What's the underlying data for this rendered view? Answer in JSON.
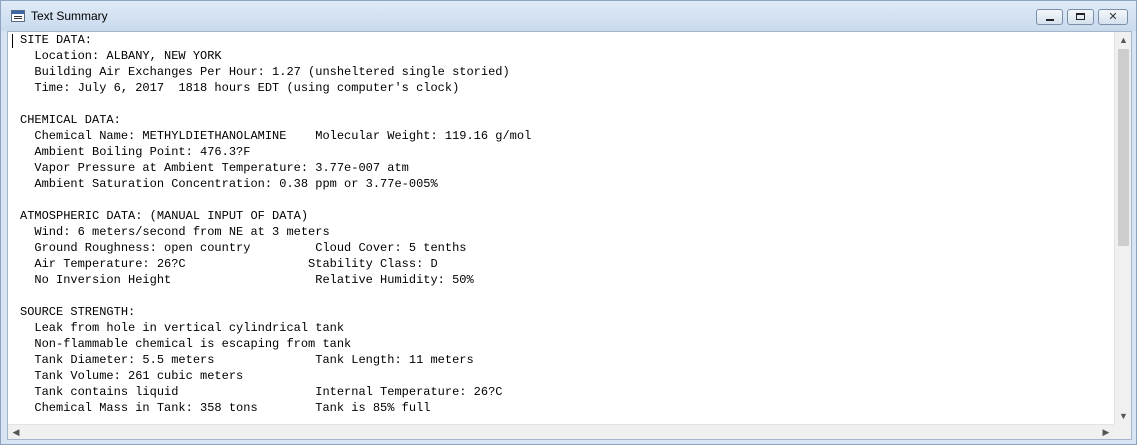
{
  "window": {
    "title": "Text Summary",
    "controls": {
      "minimize": "minimize",
      "maximize": "maximize",
      "close": "✕"
    }
  },
  "summary": {
    "lines": [
      "SITE DATA:",
      "  Location: ALBANY, NEW YORK",
      "  Building Air Exchanges Per Hour: 1.27 (unsheltered single storied)",
      "  Time: July 6, 2017  1818 hours EDT (using computer's clock)",
      "",
      "CHEMICAL DATA:",
      "  Chemical Name: METHYLDIETHANOLAMINE    Molecular Weight: 119.16 g/mol",
      "  Ambient Boiling Point: 476.3?F",
      "  Vapor Pressure at Ambient Temperature: 3.77e-007 atm",
      "  Ambient Saturation Concentration: 0.38 ppm or 3.77e-005%",
      "",
      "ATMOSPHERIC DATA: (MANUAL INPUT OF DATA)",
      "  Wind: 6 meters/second from NE at 3 meters",
      "  Ground Roughness: open country         Cloud Cover: 5 tenths",
      "  Air Temperature: 26?C                 Stability Class: D",
      "  No Inversion Height                    Relative Humidity: 50%",
      "",
      "SOURCE STRENGTH:",
      "  Leak from hole in vertical cylindrical tank",
      "  Non-flammable chemical is escaping from tank",
      "  Tank Diameter: 5.5 meters              Tank Length: 11 meters",
      "  Tank Volume: 261 cubic meters",
      "  Tank contains liquid                   Internal Temperature: 26?C",
      "  Chemical Mass in Tank: 358 tons        Tank is 85% full"
    ]
  },
  "scrollbars": {
    "vertical": {
      "up": "▲",
      "down": "▼",
      "position": 0
    },
    "horizontal": {
      "left": "◀",
      "right": "▶",
      "position": 0
    }
  }
}
